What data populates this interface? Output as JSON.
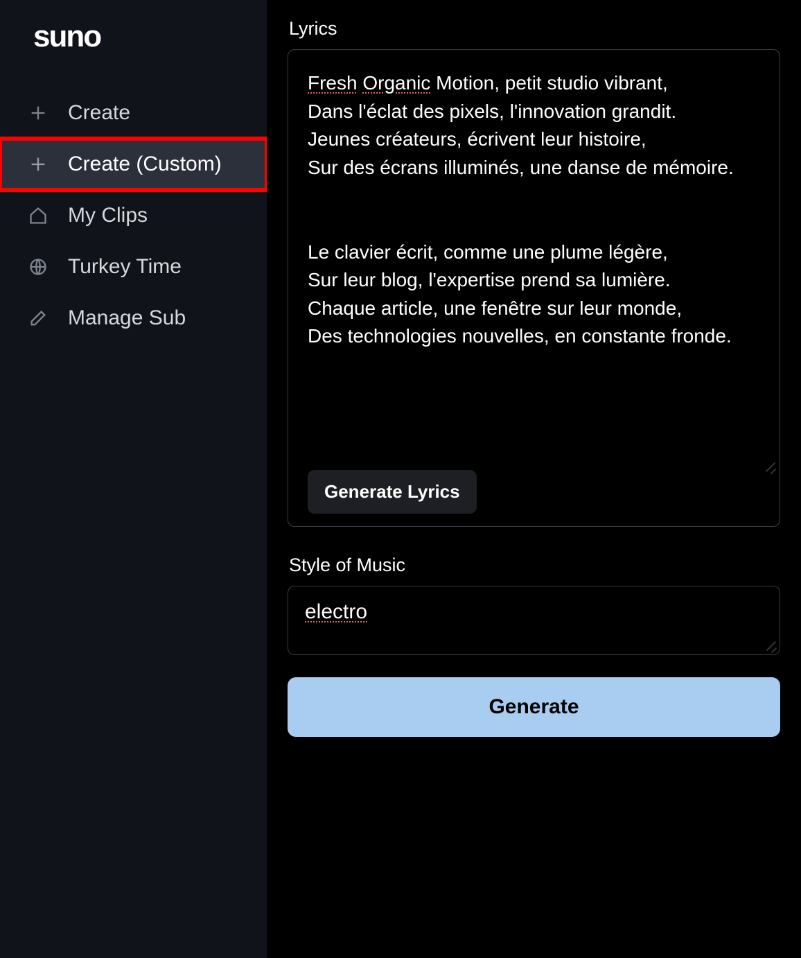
{
  "logo": "suno",
  "sidebar": {
    "items": [
      {
        "label": "Create",
        "icon": "plus-icon",
        "active": false
      },
      {
        "label": "Create (Custom)",
        "icon": "plus-icon",
        "active": true,
        "highlighted": true
      },
      {
        "label": "My Clips",
        "icon": "home-icon",
        "active": false
      },
      {
        "label": "Turkey Time",
        "icon": "globe-icon",
        "active": false
      },
      {
        "label": "Manage Sub",
        "icon": "edit-icon",
        "active": false
      }
    ]
  },
  "main": {
    "lyrics_label": "Lyrics",
    "lyrics_value": "Fresh Organic Motion, petit studio vibrant,\nDans l'éclat des pixels, l'innovation grandit.\nJeunes créateurs, écrivent leur histoire,\nSur des écrans illuminés, une danse de mémoire.\n\n\nLe clavier écrit, comme une plume légère,\nSur leur blog, l'expertise prend sa lumière.\nChaque article, une fenêtre sur leur monde,\nDes technologies nouvelles, en constante fronde.",
    "lyrics_spell_underlined_words": [
      "Fresh",
      "Organic"
    ],
    "generate_lyrics_label": "Generate Lyrics",
    "style_label": "Style of Music",
    "style_value": "electro",
    "style_spell_underlined": true,
    "generate_label": "Generate"
  },
  "colors": {
    "sidebar_bg": "#11131a",
    "active_bg": "#2b303b",
    "highlight_border": "#ff0000",
    "primary_button_bg": "#a9cdf0",
    "border": "#3a3d44"
  }
}
